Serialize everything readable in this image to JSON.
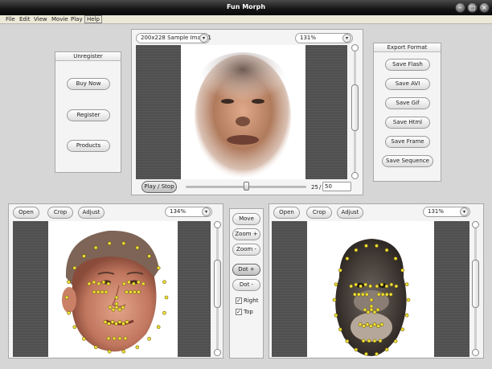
{
  "window": {
    "title": "Fun Morph"
  },
  "menu": [
    "File",
    "Edit",
    "View",
    "Movie",
    "Play",
    "Help"
  ],
  "unregister": {
    "title": "Unregister",
    "buttons": [
      "Buy Now",
      "Register",
      "Products"
    ]
  },
  "export": {
    "title": "Export Format",
    "buttons": [
      "Save Flash",
      "Save AVI",
      "Save Gif",
      "Save Html",
      "Save Frame",
      "Save Sequence"
    ]
  },
  "preview": {
    "size_select": "200x228 Sample Image1",
    "zoom": "131%",
    "play_label": "Play / Stop",
    "frame_current": "25",
    "frame_separator": "/",
    "frame_total": "50",
    "frame_progress": 0.5
  },
  "source": {
    "open": "Open",
    "crop": "Crop",
    "adjust": "Adjust",
    "zoom": "134%"
  },
  "target": {
    "open": "Open",
    "crop": "Crop",
    "adjust": "Adjust",
    "zoom": "131%"
  },
  "tools": {
    "move": "Move",
    "zoom_in": "Zoom +",
    "zoom_out": "Zoom -",
    "dot_add": "Dot +",
    "dot_remove": "Dot -",
    "right_label": "Right",
    "right_checked": true,
    "top_label": "Top",
    "top_checked": true
  },
  "icons": {
    "minimize": "minimize-icon",
    "maximize": "maximize-icon",
    "close": "close-icon",
    "dropdown": "chevron-down-icon",
    "checkmark": "check-icon"
  }
}
